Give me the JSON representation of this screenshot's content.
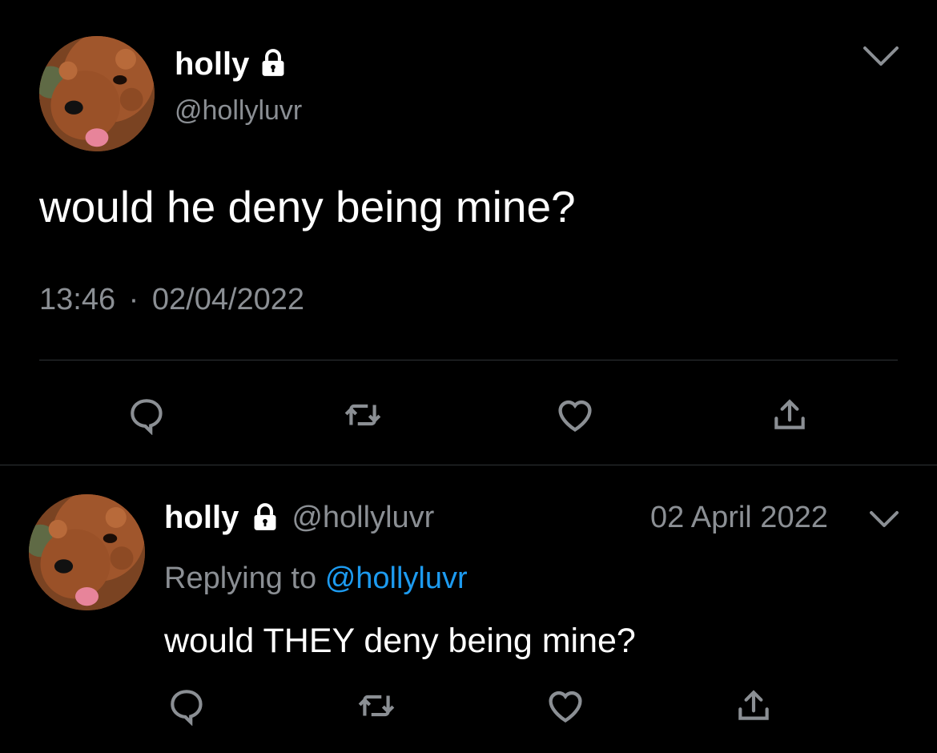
{
  "main_tweet": {
    "display_name": "holly",
    "handle": "@hollyluvr",
    "text": "would he deny being mine?",
    "time": "13:46",
    "separator": "·",
    "date": "02/04/2022",
    "avatar_icon": "poodle-avatar",
    "lock_icon": "lock-icon",
    "menu_icon": "chevron-down-icon"
  },
  "reply_tweet": {
    "display_name": "holly",
    "handle": "@hollyluvr",
    "date": "02 April 2022",
    "replying_prefix": "Replying to",
    "replying_handle": "@hollyluvr",
    "text": "would THEY deny being mine?",
    "avatar_icon": "poodle-avatar",
    "lock_icon": "lock-icon",
    "menu_icon": "chevron-down-icon"
  },
  "actions": [
    "reply-icon",
    "retweet-icon",
    "like-icon",
    "share-icon"
  ],
  "colors": {
    "background": "#000000",
    "muted": "#8b8f94",
    "link": "#1d9bf0",
    "divider": "#2f3336"
  }
}
